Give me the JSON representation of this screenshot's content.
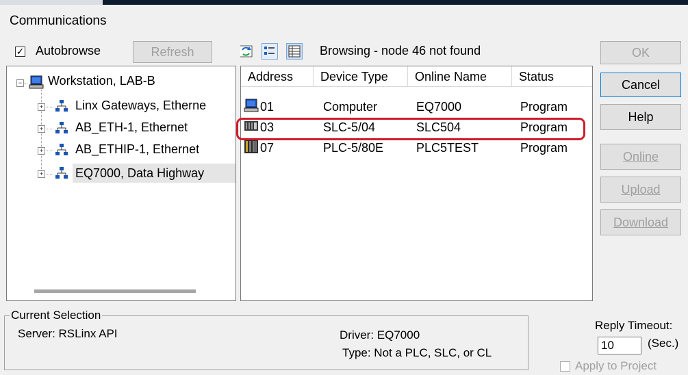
{
  "window": {
    "title": "Communications"
  },
  "toolbar": {
    "autobrowse_label": "Autobrowse",
    "autobrowse_checked": true,
    "refresh_label": "Refresh",
    "status_text": "Browsing - node 46 not found"
  },
  "tree": {
    "root": {
      "label": "Workstation, LAB-B",
      "expander": "−"
    },
    "children": [
      {
        "label": "Linx Gateways, Etherne",
        "expander": "+"
      },
      {
        "label": "AB_ETH-1, Ethernet",
        "expander": "+"
      },
      {
        "label": "AB_ETHIP-1, Ethernet",
        "expander": "+"
      },
      {
        "label": "EQ7000, Data Highway",
        "expander": "+"
      }
    ]
  },
  "devices": {
    "columns": [
      "Address",
      "Device Type",
      "Online Name",
      "Status"
    ],
    "rows": [
      {
        "address": "01",
        "device_type": "Computer",
        "online_name": "EQ7000",
        "status": "Program",
        "icon": "computer-icon"
      },
      {
        "address": "03",
        "device_type": "SLC-5/04",
        "online_name": "SLC504",
        "status": "Program",
        "icon": "slc-rack-icon",
        "highlighted": true
      },
      {
        "address": "07",
        "device_type": "PLC-5/80E",
        "online_name": "PLC5TEST",
        "status": "Program",
        "icon": "plc5-rack-icon"
      }
    ],
    "highlight_color": "#d01c2b"
  },
  "buttons": {
    "ok": "OK",
    "cancel": "Cancel",
    "help": "Help",
    "online": "Online",
    "upload": "Upload",
    "download": "Download"
  },
  "selection": {
    "legend": "Current Selection",
    "server": "Server: RSLinx API",
    "driver": "Driver: EQ7000",
    "type": "Type: Not a PLC, SLC, or CL"
  },
  "reply": {
    "label": "Reply Timeout:",
    "value": "10",
    "unit": "(Sec.)",
    "apply_label": "Apply to Project"
  }
}
